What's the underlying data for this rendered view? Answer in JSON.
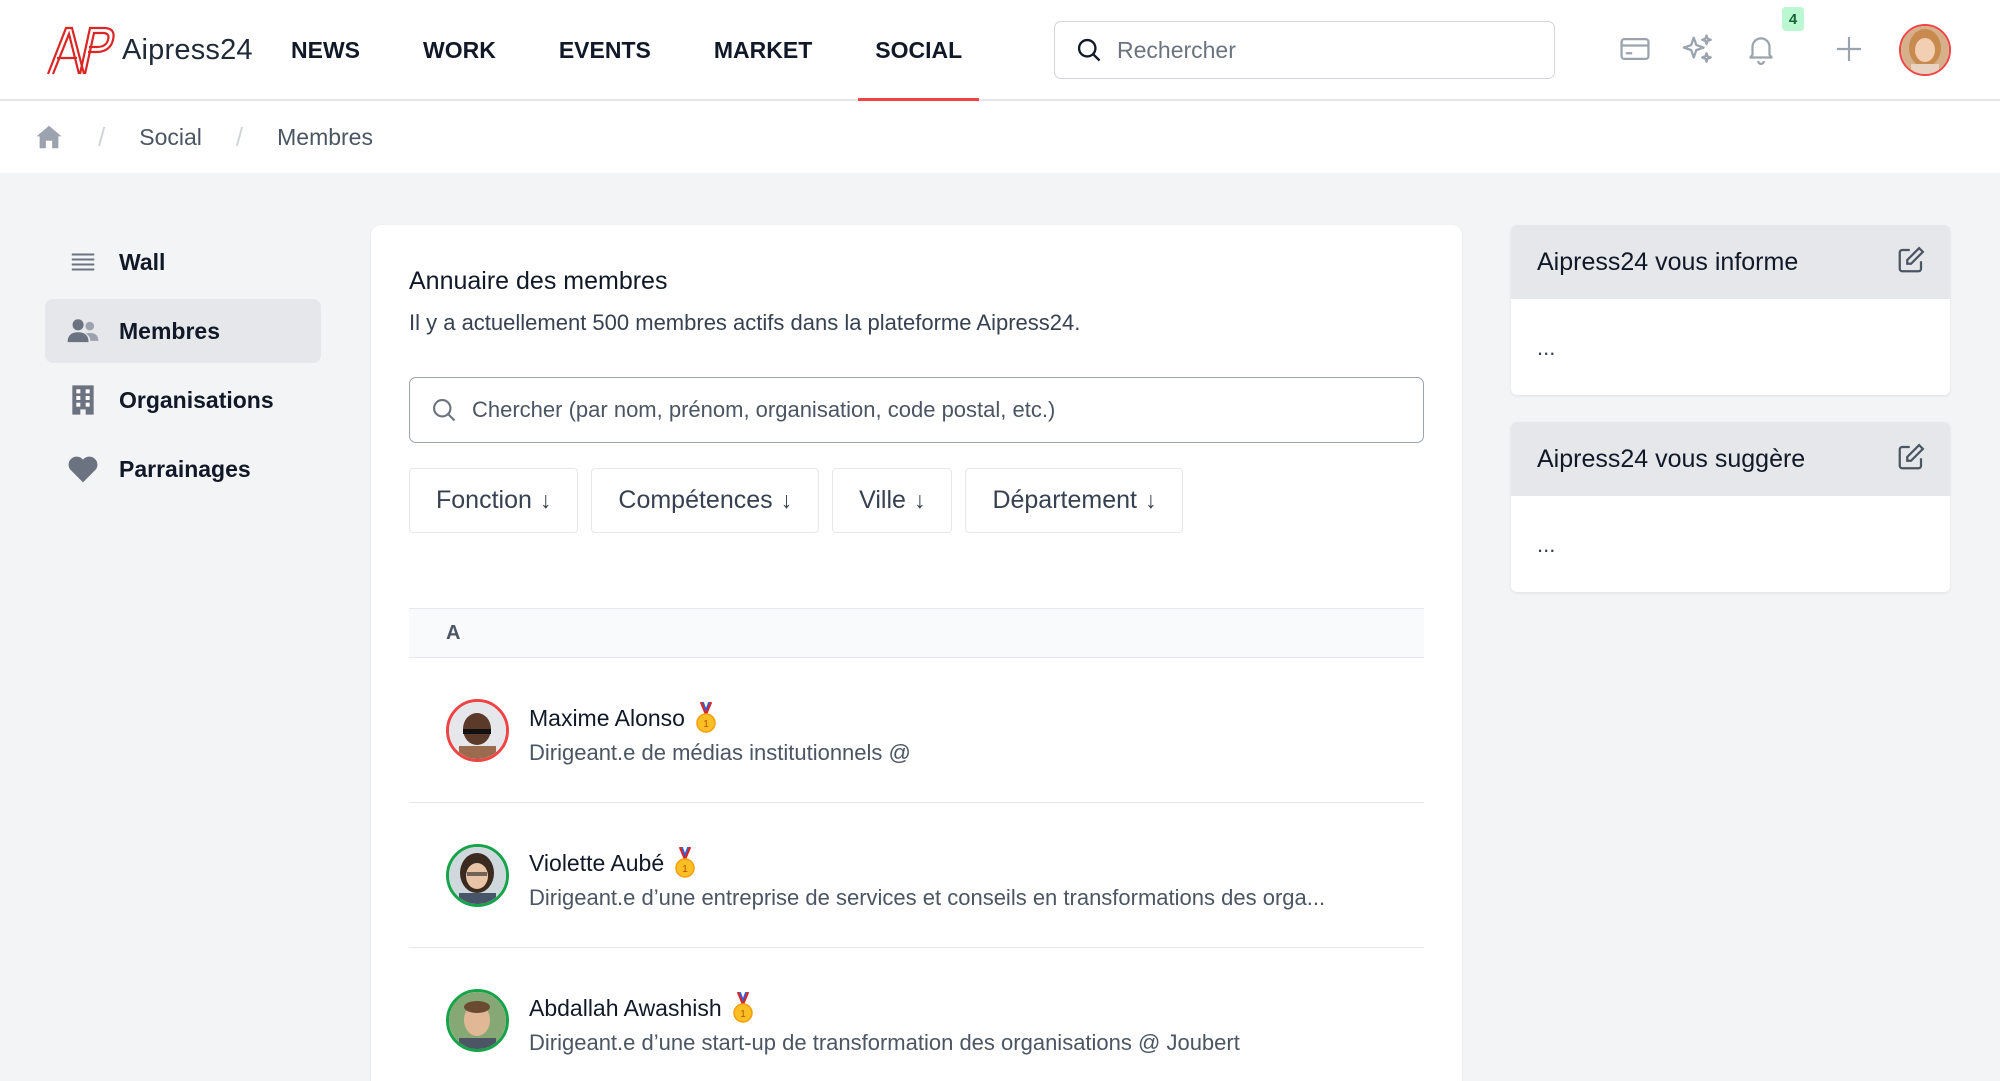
{
  "header": {
    "brand": "Aipress24",
    "nav": [
      {
        "label": "NEWS",
        "active": false
      },
      {
        "label": "WORK",
        "active": false
      },
      {
        "label": "EVENTS",
        "active": false
      },
      {
        "label": "MARKET",
        "active": false
      },
      {
        "label": "SOCIAL",
        "active": true
      }
    ],
    "search_placeholder": "Rechercher",
    "notifications_count": "4",
    "icons": [
      "card-icon",
      "sparkles-icon",
      "bell-icon",
      "plus-icon"
    ]
  },
  "breadcrumb": {
    "items": [
      "Social",
      "Membres"
    ]
  },
  "sidebar": {
    "items": [
      {
        "label": "Wall",
        "icon": "list-icon",
        "active": false
      },
      {
        "label": "Membres",
        "icon": "users-icon",
        "active": true
      },
      {
        "label": "Organisations",
        "icon": "building-icon",
        "active": false
      },
      {
        "label": "Parrainages",
        "icon": "heart-icon",
        "active": false
      }
    ]
  },
  "main": {
    "title": "Annuaire des membres",
    "subtitle": "Il y a actuellement 500 membres actifs dans la plateforme Aipress24.",
    "search_placeholder": "Chercher (par nom, prénom, organisation, code postal, etc.)",
    "filters": [
      "Fonction",
      "Compétences",
      "Ville",
      "Département"
    ],
    "letter": "A",
    "members": [
      {
        "name": "Maxime Alonso",
        "role": "Dirigeant.e de médias institutionnels @",
        "ring_color": "#ef4444"
      },
      {
        "name": "Violette Aubé",
        "role": "Dirigeant.e d’une entreprise de services et conseils en transformations des orga...",
        "ring_color": "#16a34a"
      },
      {
        "name": "Abdallah Awashish",
        "role": "Dirigeant.e d’une start-up de transformation des organisations @ Joubert",
        "ring_color": "#16a34a"
      }
    ]
  },
  "widgets": [
    {
      "title": "Aipress24 vous informe",
      "body": "..."
    },
    {
      "title": "Aipress24 vous suggère",
      "body": "..."
    }
  ]
}
